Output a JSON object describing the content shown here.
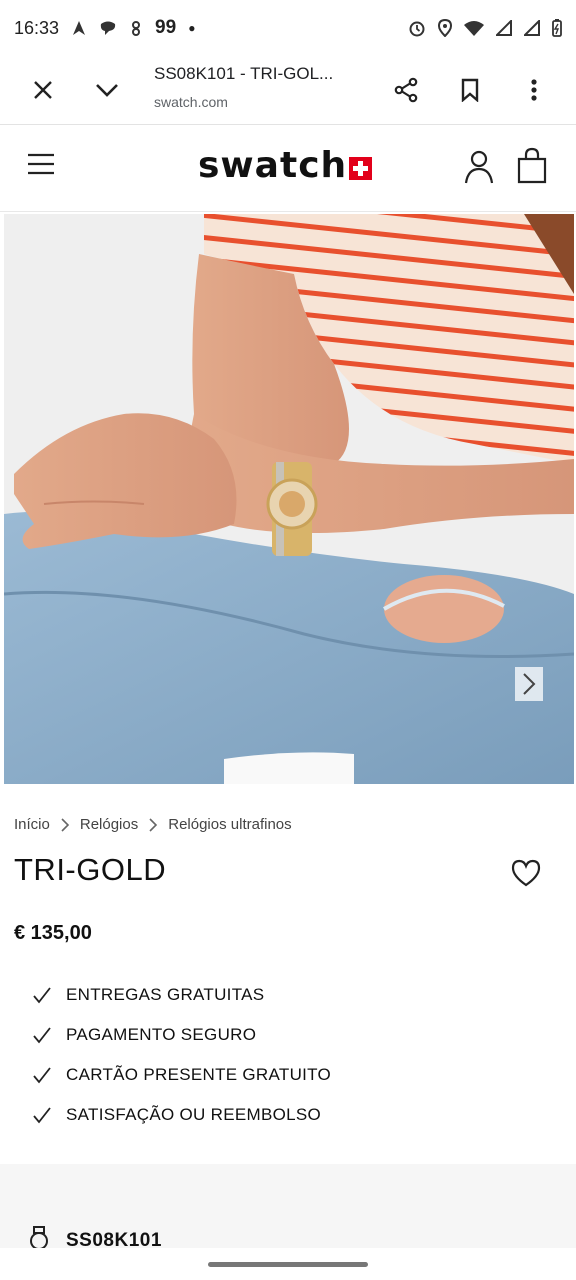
{
  "status_bar": {
    "time": "16:33",
    "notification_count": "99"
  },
  "browser": {
    "page_title": "SS08K101 - TRI-GOL...",
    "url": "swatch.com"
  },
  "site": {
    "logo_text": "swatch"
  },
  "breadcrumb": [
    "Início",
    "Relógios",
    "Relógios ultrafinos"
  ],
  "product": {
    "name": "TRI-GOLD",
    "price": "€ 135,00",
    "sku": "SS08K101"
  },
  "benefits": [
    "ENTREGAS GRATUITAS",
    "PAGAMENTO SEGURO",
    "CARTÃO PRESENTE GRATUITO",
    "SATISFAÇÃO OU REEMBOLSO"
  ],
  "colors": {
    "brand_red": "#e2001a",
    "shirt_stripe": "#e8502e",
    "denim": "#8fb0cc"
  },
  "icons": [
    "close-icon",
    "chevron-down-icon",
    "share-icon",
    "bookmark-icon",
    "more-icon",
    "menu-icon",
    "account-icon",
    "bag-icon",
    "chevron-right-icon",
    "heart-icon",
    "check-icon",
    "watch-icon"
  ]
}
